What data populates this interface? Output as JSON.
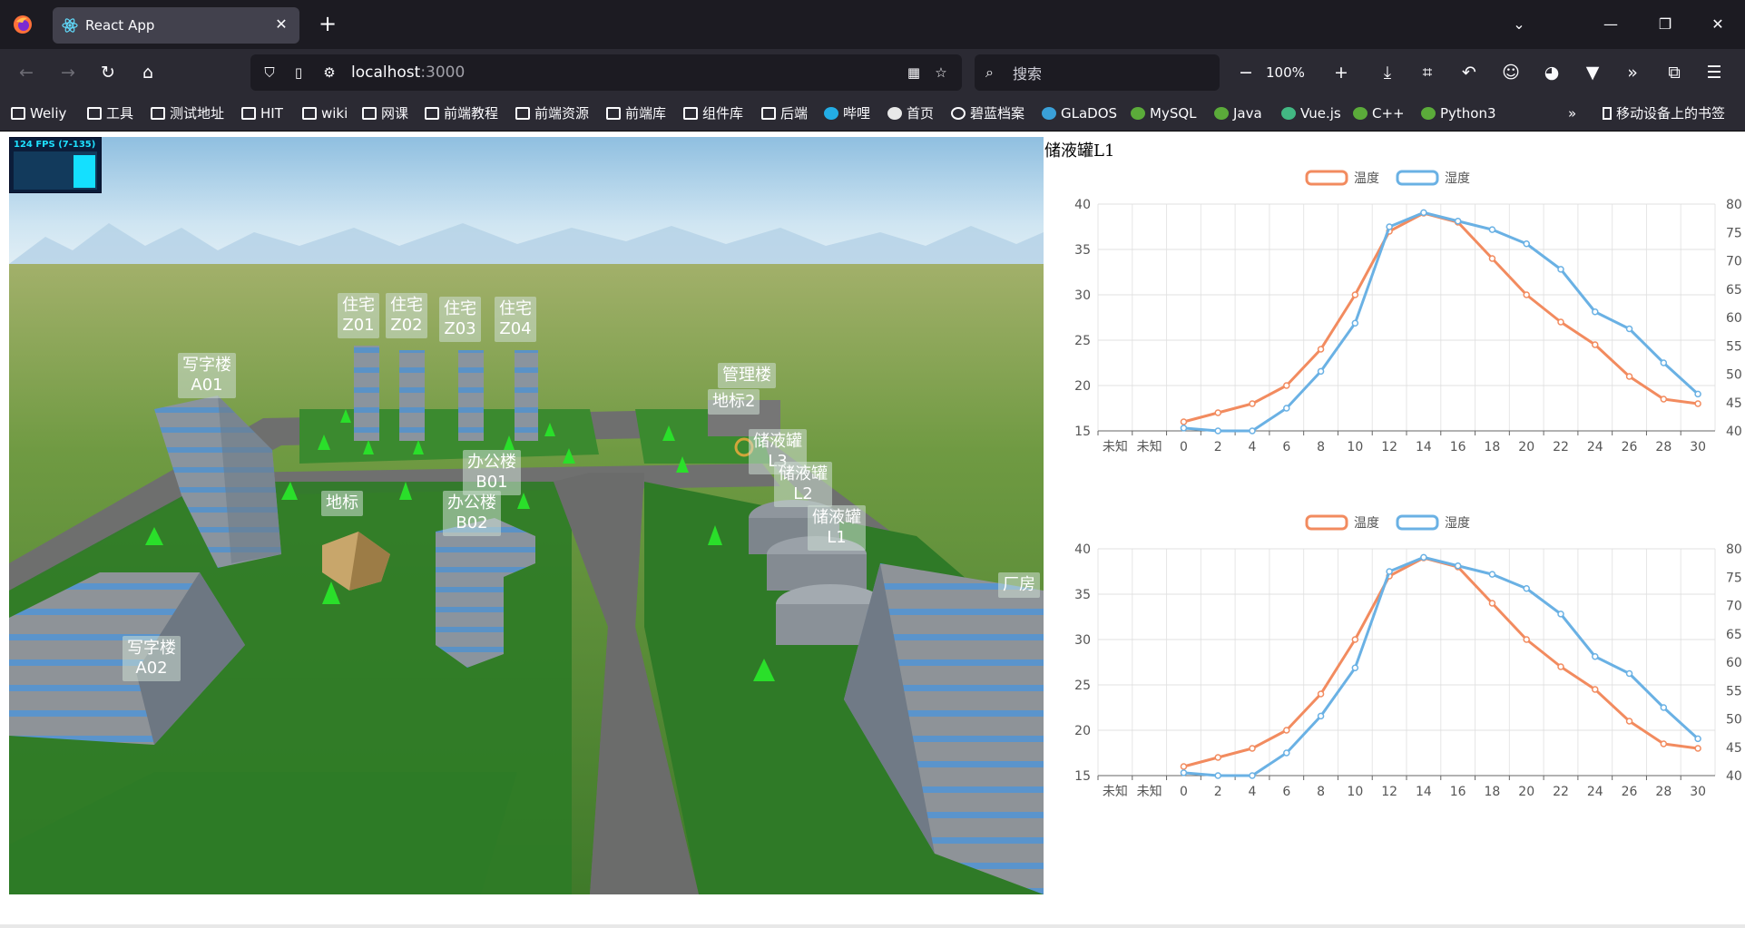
{
  "browser": {
    "tab_title": "React App",
    "url_host": "localhost",
    "url_port": ":3000",
    "search_placeholder": "搜索",
    "zoom": "100%",
    "colors": {
      "tabbar": "#1c1b22",
      "toolbar": "#2b2a33",
      "text": "#fbfbfe"
    }
  },
  "bookmarks": [
    {
      "label": "Weliy",
      "icon": "folder-icon"
    },
    {
      "label": "工具",
      "icon": "folder-icon"
    },
    {
      "label": "测试地址",
      "icon": "folder-icon"
    },
    {
      "label": "HIT",
      "icon": "folder-icon"
    },
    {
      "label": "wiki",
      "icon": "folder-icon"
    },
    {
      "label": "网课",
      "icon": "folder-icon"
    },
    {
      "label": "前端教程",
      "icon": "folder-icon"
    },
    {
      "label": "前端资源",
      "icon": "folder-icon"
    },
    {
      "label": "前端库",
      "icon": "folder-icon"
    },
    {
      "label": "组件库",
      "icon": "folder-icon"
    },
    {
      "label": "后端",
      "icon": "folder-icon"
    },
    {
      "label": "哔哩",
      "icon": "bilibili-icon"
    },
    {
      "label": "首页",
      "icon": "site-icon"
    },
    {
      "label": "碧蓝档案",
      "icon": "globe-icon"
    },
    {
      "label": "GLaDOS",
      "icon": "chart-site-icon"
    },
    {
      "label": "MySQL",
      "icon": "site-dot-icon"
    },
    {
      "label": "Java",
      "icon": "site-dot-icon"
    },
    {
      "label": "Vue.js",
      "icon": "vue-icon"
    },
    {
      "label": "C++",
      "icon": "site-dot-icon"
    },
    {
      "label": "Python3",
      "icon": "site-dot-icon"
    }
  ],
  "mobile_bookmarks": "移动设备上的书签",
  "scene": {
    "fps_text": "124 FPS (7-135)",
    "labels": [
      {
        "id": "z01",
        "text": "住宅\nZ01"
      },
      {
        "id": "z02",
        "text": "住宅\nZ02"
      },
      {
        "id": "z03",
        "text": "住宅\nZ03"
      },
      {
        "id": "z04",
        "text": "住宅\nZ04"
      },
      {
        "id": "a01",
        "text": "写字楼\nA01"
      },
      {
        "id": "mgmt",
        "text": "管理楼"
      },
      {
        "id": "landmark2",
        "text": "地标2"
      },
      {
        "id": "l3",
        "text": "储液罐\nL3"
      },
      {
        "id": "l2",
        "text": "储液罐\nL2"
      },
      {
        "id": "l1",
        "text": "储液罐\nL1"
      },
      {
        "id": "b01",
        "text": "办公楼\nB01"
      },
      {
        "id": "b02",
        "text": "办公楼\nB02"
      },
      {
        "id": "landmark",
        "text": "地标"
      },
      {
        "id": "factory",
        "text": "厂房"
      },
      {
        "id": "a02",
        "text": "写字楼\nA02"
      }
    ]
  },
  "panel": {
    "title": "储液罐L1"
  },
  "chart_data": [
    {
      "type": "line",
      "categories": [
        "未知",
        "未知",
        "0",
        "2",
        "4",
        "6",
        "8",
        "10",
        "12",
        "14",
        "16",
        "18",
        "20",
        "22",
        "24",
        "26",
        "28",
        "30"
      ],
      "series": [
        {
          "name": "温度",
          "axis": "left",
          "color": "#f28b5f",
          "values": [
            null,
            null,
            16,
            17,
            18,
            20,
            24,
            30,
            37,
            39,
            38,
            34,
            30,
            27,
            24.5,
            21,
            18.5,
            18
          ]
        },
        {
          "name": "湿度",
          "axis": "right",
          "color": "#6ab1e4",
          "values": [
            null,
            null,
            40.5,
            40,
            40,
            44,
            50.5,
            59,
            76,
            78.5,
            77,
            75.5,
            73,
            68.5,
            61,
            58,
            52,
            46.5
          ]
        }
      ],
      "y_left": {
        "min": 15,
        "max": 40,
        "ticks": [
          15,
          20,
          25,
          30,
          35,
          40
        ]
      },
      "y_right": {
        "min": 40,
        "max": 80,
        "ticks": [
          40,
          45,
          50,
          55,
          60,
          65,
          70,
          75,
          80
        ]
      },
      "legend": "top-center",
      "grid": true
    },
    {
      "type": "line",
      "categories": [
        "未知",
        "未知",
        "0",
        "2",
        "4",
        "6",
        "8",
        "10",
        "12",
        "14",
        "16",
        "18",
        "20",
        "22",
        "24",
        "26",
        "28",
        "30"
      ],
      "series": [
        {
          "name": "温度",
          "axis": "left",
          "color": "#f28b5f",
          "values": [
            null,
            null,
            16,
            17,
            18,
            20,
            24,
            30,
            37,
            39,
            38,
            34,
            30,
            27,
            24.5,
            21,
            18.5,
            18
          ]
        },
        {
          "name": "湿度",
          "axis": "right",
          "color": "#6ab1e4",
          "values": [
            null,
            null,
            40.5,
            40,
            40,
            44,
            50.5,
            59,
            76,
            78.5,
            77,
            75.5,
            73,
            68.5,
            61,
            58,
            52,
            46.5
          ]
        }
      ],
      "y_left": {
        "min": 15,
        "max": 40,
        "ticks": [
          15,
          20,
          25,
          30,
          35,
          40
        ]
      },
      "y_right": {
        "min": 40,
        "max": 80,
        "ticks": [
          40,
          45,
          50,
          55,
          60,
          65,
          70,
          75,
          80
        ]
      },
      "legend": "top-center",
      "grid": true
    }
  ]
}
